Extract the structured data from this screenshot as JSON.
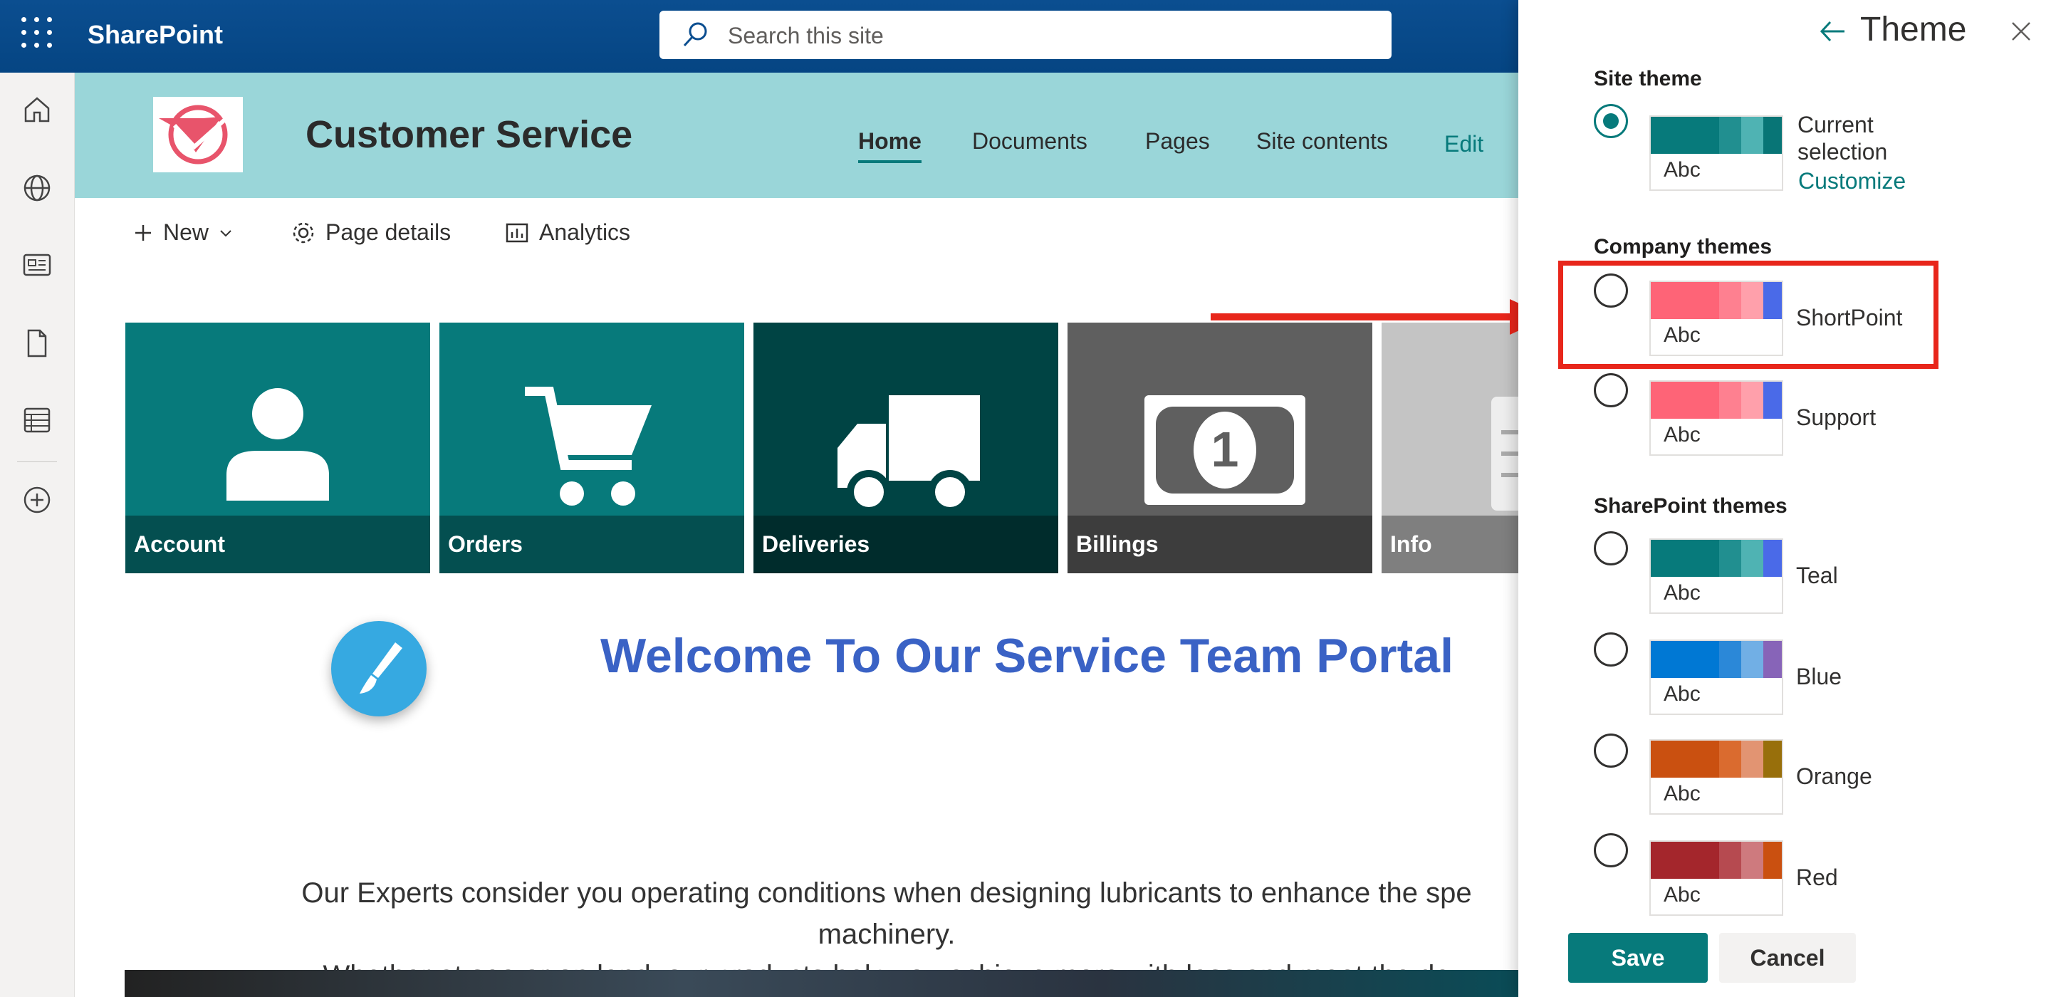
{
  "suite": {
    "brand": "SharePoint",
    "search_placeholder": "Search this site"
  },
  "site": {
    "title": "Customer Service",
    "nav": [
      {
        "label": "Home",
        "active": true
      },
      {
        "label": "Documents"
      },
      {
        "label": "Pages"
      },
      {
        "label": "Site contents"
      }
    ],
    "edit_label": "Edit"
  },
  "commandbar": {
    "new_label": "New",
    "page_details_label": "Page details",
    "analytics_label": "Analytics"
  },
  "tiles": [
    {
      "label": "Account",
      "color": "#077a7b",
      "icon": "person-icon"
    },
    {
      "label": "Orders",
      "color": "#077a7b",
      "icon": "cart-icon"
    },
    {
      "label": "Deliveries",
      "color": "#004444",
      "icon": "truck-icon"
    },
    {
      "label": "Billings",
      "color": "#5f5f5f",
      "icon": "money-icon"
    },
    {
      "label": "Info",
      "color": "#c4c4c4",
      "icon": "document-icon"
    }
  ],
  "content": {
    "welcome": "Welcome To Our Service Team Portal",
    "paragraph_line1": "Our Experts consider you operating conditions when designing lubricants to enhance the spe",
    "paragraph_line2": "machinery.",
    "paragraph_line3": "Whether at sea or on land, our products help you achieve more with less and meet the de"
  },
  "theme_panel": {
    "title": "Theme",
    "site_theme_heading": "Site theme",
    "current_selection_label": "Current selection",
    "customize_label": "Customize",
    "company_themes_heading": "Company themes",
    "sharepoint_themes_heading": "SharePoint themes",
    "swatch_text": "Abc",
    "current": {
      "colors": [
        "#077a7b",
        "#077a7b",
        "#218f90",
        "#4fb3b3",
        "#087576"
      ]
    },
    "company_themes": [
      {
        "name": "ShortPoint",
        "colors": [
          "#fe6477",
          "#fe6477",
          "#fe8090",
          "#ffa0ab",
          "#4a6ae8"
        ],
        "highlighted": true
      },
      {
        "name": "Support",
        "colors": [
          "#fe6477",
          "#fe6477",
          "#fe8090",
          "#ffa0ab",
          "#4a6ae8"
        ]
      }
    ],
    "sharepoint_themes": [
      {
        "name": "Teal",
        "colors": [
          "#077a7b",
          "#077a7b",
          "#218f90",
          "#4fb3b3",
          "#4a6ae8"
        ]
      },
      {
        "name": "Blue",
        "colors": [
          "#0078d4",
          "#0078d4",
          "#2b88d8",
          "#71afe5",
          "#8764b8"
        ]
      },
      {
        "name": "Orange",
        "colors": [
          "#ca5010",
          "#ca5010",
          "#da6b2f",
          "#e29472",
          "#986f0b"
        ]
      },
      {
        "name": "Red",
        "colors": [
          "#a4262c",
          "#a4262c",
          "#b64a50",
          "#ce7a7e",
          "#ca5010"
        ]
      }
    ],
    "save_label": "Save",
    "cancel_label": "Cancel"
  },
  "accent": "#077a7b",
  "annotation_color": "#e8261b"
}
